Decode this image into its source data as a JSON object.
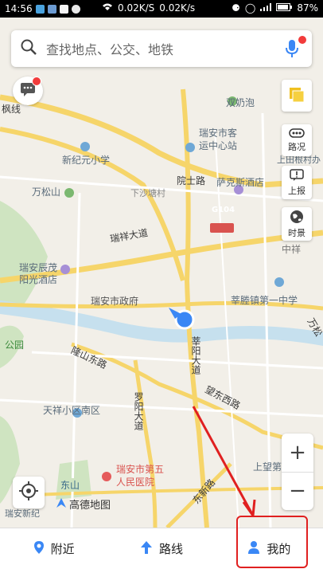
{
  "status": {
    "time": "14:56",
    "speed_up": "0.02K/S",
    "speed_down": "0.02K/s",
    "battery": "87%"
  },
  "search": {
    "placeholder": "查找地点、公交、地铁"
  },
  "side_buttons": {
    "traffic": "路况",
    "report": "上报",
    "street_view": "时景"
  },
  "zoom": {
    "plus": "+",
    "minus": "−"
  },
  "map_labels": {
    "fenglin": "枫线",
    "shuangnai": "双奶泡",
    "ruian_station": "瑞安市客",
    "station2": "运中心站",
    "shangtian": "上田根村办",
    "xinjiyuan": "新纪元小学",
    "yuanshi": "院士路",
    "wansong": "万松山",
    "sakesi": "萨克斯酒店",
    "xiasha": "下沙塘村",
    "g104": "G104",
    "ruixiang": "瑞祥大道",
    "zhongxiang": "中祥",
    "ruian_hotel1": "瑞安辰茂",
    "ruian_hotel2": "阳光酒店",
    "gov": "瑞安市政府",
    "huafeng": "莘塍镇第一中学",
    "wan": "万松",
    "park": "公园",
    "longshan": "隆山东路",
    "xinyang": "莘阳大道",
    "luoyang": "罗阳大道",
    "wangdong": "望东西路",
    "tianxiang": "天祥小区南区",
    "hospital1": "瑞安市第五",
    "hospital2": "人民医院",
    "dongshan": "东山",
    "dongxin": "东新路",
    "shangwang": "上望第一中",
    "ruian_xin": "瑞安新纪",
    "gaode": "高德地图"
  },
  "tabs": {
    "nearby": "附近",
    "route": "路线",
    "mine": "我的"
  },
  "colors": {
    "accent": "#3a87f5",
    "annotation": "#e02020"
  }
}
